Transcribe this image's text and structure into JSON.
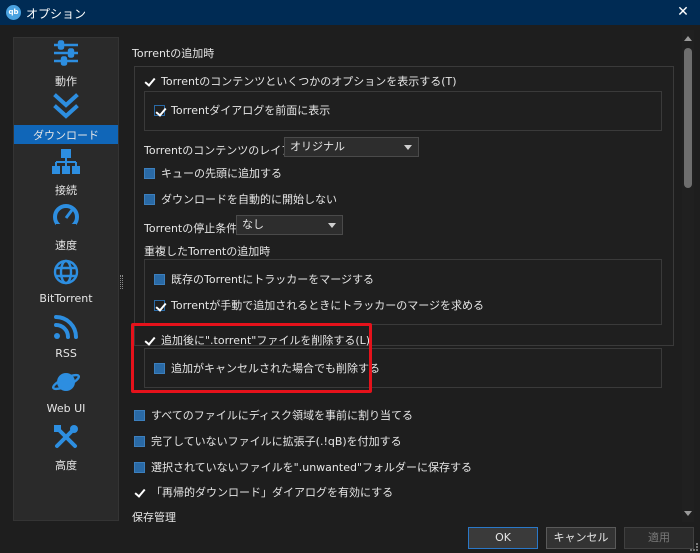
{
  "window": {
    "app_icon_text": "qb",
    "title": "オプション",
    "close_glyph": "✕"
  },
  "sidebar": {
    "items": [
      {
        "label": "動作",
        "icon": "sliders-icon"
      },
      {
        "label": "ダウンロード",
        "icon": "double-chevron-down-icon",
        "active": true
      },
      {
        "label": "接続",
        "icon": "network-icon"
      },
      {
        "label": "速度",
        "icon": "speedometer-icon"
      },
      {
        "label": "BitTorrent",
        "icon": "globe-icon"
      },
      {
        "label": "RSS",
        "icon": "rss-icon"
      },
      {
        "label": "Web UI",
        "icon": "planet-icon"
      },
      {
        "label": "高度",
        "icon": "tools-icon"
      }
    ]
  },
  "main": {
    "section_add": "Torrentの追加時",
    "show_content": {
      "label": "Torrentのコンテンツといくつかのオプションを表示する(T)",
      "checked": true
    },
    "bring_front": {
      "label": "Torrentダイアログを前面に表示",
      "checked": true
    },
    "layout_label": "Torrentのコンテンツのレイアウト:",
    "layout_value": "オリジナル",
    "queue_top": {
      "label": "キューの先頭に追加する",
      "checked": false
    },
    "no_autostart": {
      "label": "ダウンロードを自動的に開始しない",
      "checked": false
    },
    "stop_label": "Torrentの停止条件:",
    "stop_value": "なし",
    "section_dup": "重複したTorrentの追加時",
    "merge_trackers": {
      "label": "既存のTorrentにトラッカーをマージする",
      "checked": false
    },
    "ask_merge": {
      "label": "Torrentが手動で追加されるときにトラッカーのマージを求める",
      "checked": true
    },
    "delete_torrent": {
      "label": "追加後に\".torrent\"ファイルを削除する(L)",
      "checked": true
    },
    "delete_cancel": {
      "label": "追加がキャンセルされた場合でも削除する",
      "checked": false
    },
    "prealloc": {
      "label": "すべてのファイルにディスク領域を事前に割り当てる",
      "checked": false
    },
    "append_ext": {
      "label": "完了していないファイルに拡張子(.!qB)を付加する",
      "checked": false
    },
    "unwanted": {
      "label": "選択されていないファイルを\".unwanted\"フォルダーに保存する",
      "checked": false
    },
    "recursive": {
      "label": "「再帰的ダウンロード」ダイアログを有効にする",
      "checked": true
    },
    "section_save": "保存管理"
  },
  "buttons": {
    "ok": "OK",
    "cancel": "キャンセル",
    "apply": "適用"
  },
  "colors": {
    "titlebar": "#002b54",
    "accent": "#1066b8",
    "highlight": "#e5121b",
    "icon": "#2d8ee0"
  }
}
